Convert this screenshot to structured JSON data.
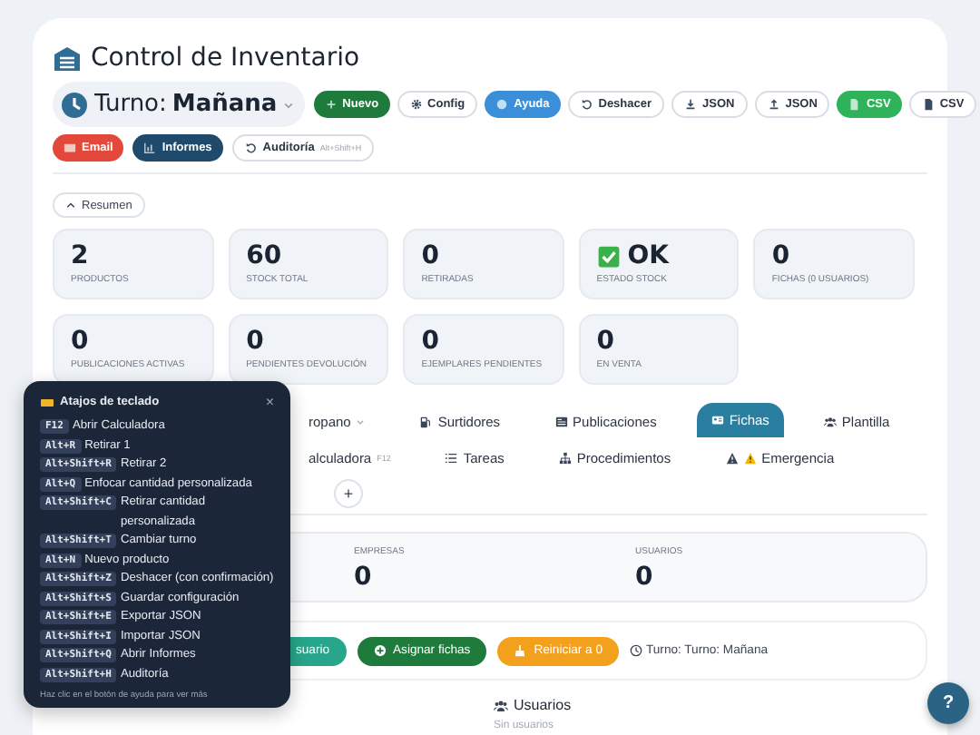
{
  "title": "Control de Inventario",
  "shift_selector": {
    "label": "Turno:",
    "value": "Mañana"
  },
  "toolbar": [
    {
      "label": "Nuevo",
      "kind": "solid",
      "color": "#1e7b3c"
    },
    {
      "label": "Config",
      "kind": "outline"
    },
    {
      "label": "Ayuda",
      "kind": "solid",
      "color": "#3a8fd8"
    },
    {
      "label": "Deshacer",
      "kind": "outline"
    },
    {
      "label": "JSON",
      "kind": "outline"
    },
    {
      "label": "JSON",
      "kind": "outline"
    },
    {
      "label": "CSV",
      "kind": "solid",
      "color": "#2eb35a"
    },
    {
      "label": "CSV",
      "kind": "outline"
    }
  ],
  "toolbar_row2": [
    {
      "label": "Email",
      "kind": "solid",
      "color": "#e2493b"
    },
    {
      "label": "Informes",
      "kind": "solid",
      "color": "#1f4a6b"
    },
    {
      "label": "Auditoría",
      "kind": "outline",
      "shortcut": "Alt+Shift+H"
    }
  ],
  "summary_toggle": {
    "label": "Resumen",
    "expanded": true
  },
  "stats": [
    {
      "value": "2",
      "label": "PRODUCTOS"
    },
    {
      "value": "60",
      "label": "STOCK TOTAL"
    },
    {
      "value": "0",
      "label": "RETIRADAS"
    },
    {
      "value": "OK",
      "label": "ESTADO STOCK",
      "kind": "status"
    },
    {
      "value": "0",
      "label": "FICHAS (0 USUARIOS)"
    },
    {
      "value": "0",
      "label": "PUBLICACIONES ACTIVAS"
    },
    {
      "value": "0",
      "label": "PENDIENTES DEVOLUCIÓN"
    },
    {
      "value": "0",
      "label": "EJEMPLARES PENDIENTES"
    },
    {
      "value": "0",
      "label": "EN VENTA"
    }
  ],
  "tabs": [
    {
      "label": "ropano",
      "selected": false,
      "dropdown": true
    },
    {
      "label": "Surtidores",
      "selected": false
    },
    {
      "label": "Publicaciones",
      "selected": false
    },
    {
      "label": "Fichas",
      "selected": true
    },
    {
      "label": "Plantilla",
      "selected": false
    }
  ],
  "tabs_row2": [
    {
      "label": "alculadora",
      "selected": false,
      "shortcut": "F12"
    },
    {
      "label": "Tareas",
      "selected": false
    },
    {
      "label": "Procedimientos",
      "selected": false
    },
    {
      "label": "Emergencia",
      "selected": false
    }
  ],
  "add_button": "+",
  "counters": [
    {
      "label": "EMPRESAS",
      "value": "0"
    },
    {
      "label": "USUARIOS",
      "value": "0"
    }
  ],
  "actions": [
    {
      "label": "suario",
      "color": "#27a68b"
    },
    {
      "label": "Asignar fichas",
      "color": "#1e7b3c"
    },
    {
      "label": "Reiniciar a 0",
      "color": "#f3a11c"
    }
  ],
  "shift_note": "Turno: Turno: Mañana",
  "users": {
    "heading": "Usuarios",
    "empty": "Sin usuarios"
  },
  "help_button": "?",
  "shortcuts_popup": {
    "title": "Atajos de teclado",
    "close": "×",
    "items": [
      {
        "key": "F12",
        "action": "Abrir Calculadora"
      },
      {
        "key": "Alt+R",
        "action": "Retirar 1"
      },
      {
        "key": "Alt+Shift+R",
        "action": "Retirar 2"
      },
      {
        "key": "Alt+Q",
        "action": "Enfocar cantidad personalizada"
      },
      {
        "key": "Alt+Shift+C",
        "action": "Retirar cantidad personalizada"
      },
      {
        "key": "Alt+Shift+T",
        "action": "Cambiar turno"
      },
      {
        "key": "Alt+N",
        "action": "Nuevo producto"
      },
      {
        "key": "Alt+Shift+Z",
        "action": "Deshacer (con confirmación)"
      },
      {
        "key": "Alt+Shift+S",
        "action": "Guardar configuración"
      },
      {
        "key": "Alt+Shift+E",
        "action": "Exportar JSON"
      },
      {
        "key": "Alt+Shift+I",
        "action": "Importar JSON"
      },
      {
        "key": "Alt+Shift+Q",
        "action": "Abrir Informes"
      },
      {
        "key": "Alt+Shift+H",
        "action": "Auditoría"
      }
    ],
    "footer": "Haz clic en el botón de ayuda para ver más"
  }
}
